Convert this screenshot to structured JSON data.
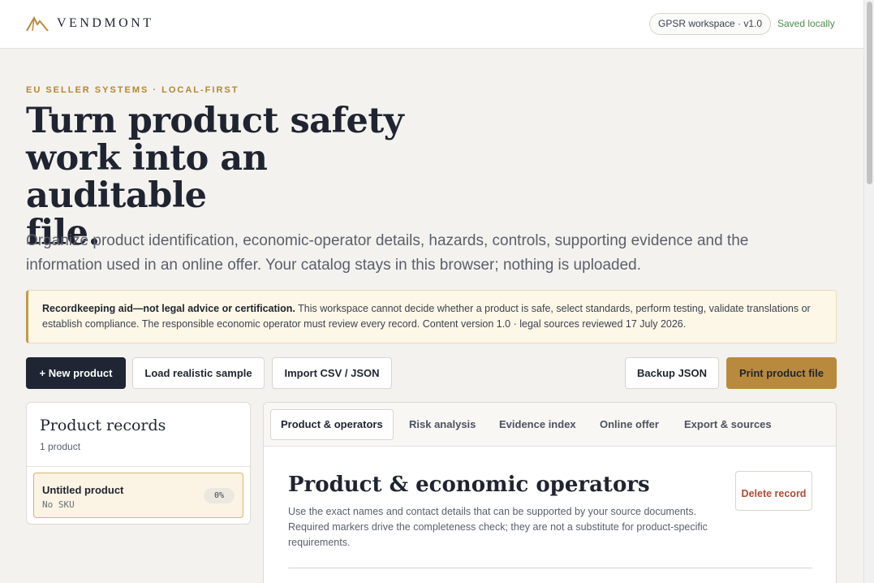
{
  "header": {
    "brand": "VENDMONT",
    "workspace_badge": "GPSR workspace · v1.0",
    "save_status": "Saved locally"
  },
  "hero": {
    "eyebrow": "EU SELLER SYSTEMS · LOCAL-FIRST",
    "title_line1": "Turn product safety",
    "title_line2": "work into an auditable",
    "title_line3": "file.",
    "subtitle": "Organize product identification, economic-operator details, hazards, controls, supporting evidence and the information used in an online offer. Your catalog stays in this browser; nothing is uploaded."
  },
  "notice": {
    "bold": "Recordkeeping aid—not legal advice or certification.",
    "text": " This workspace cannot decide whether a product is safe, select standards, perform testing, validate translations or establish compliance. The responsible economic operator must review every record. Content version 1.0 · legal sources reviewed 17 July 2026."
  },
  "toolbar": {
    "new_product": "+ New product",
    "load_sample": "Load realistic sample",
    "import": "Import CSV / JSON",
    "backup": "Backup JSON",
    "print": "Print product file"
  },
  "records": {
    "title": "Product records",
    "count": "1 product",
    "items": [
      {
        "name": "Untitled product",
        "sku": "No SKU",
        "completeness": "0%"
      }
    ]
  },
  "editor": {
    "tabs": [
      {
        "label": "Product & operators",
        "active": true
      },
      {
        "label": "Risk analysis",
        "active": false
      },
      {
        "label": "Evidence index",
        "active": false
      },
      {
        "label": "Online offer",
        "active": false
      },
      {
        "label": "Export & sources",
        "active": false
      }
    ],
    "section_title": "Product & economic operators",
    "section_desc": "Use the exact names and contact details that can be supported by your source documents. Required markers drive the completeness check; they are not a substitute for product-specific requirements.",
    "delete_label": "Delete record"
  },
  "colors": {
    "accent_gold": "#b98a3d",
    "dark": "#1f2533",
    "danger": "#b04a3a",
    "saved_green": "#4f8a4a"
  }
}
